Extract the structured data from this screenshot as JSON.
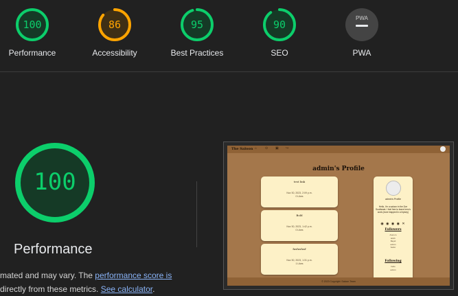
{
  "gauges": [
    {
      "score": "100",
      "label": "Performance",
      "value": 1.0,
      "color": "#0cce6b",
      "fill": "#153a26"
    },
    {
      "score": "86",
      "label": "Accessibility",
      "value": 0.86,
      "color": "#ffa400",
      "fill": "#3e2f15"
    },
    {
      "score": "95",
      "label": "Best Practices",
      "value": 0.95,
      "color": "#0cce6b",
      "fill": "#153a26"
    },
    {
      "score": "90",
      "label": "SEO",
      "value": 0.9,
      "color": "#0cce6b",
      "fill": "#153a26"
    },
    {
      "score": "",
      "label": "PWA",
      "badge": "PWA",
      "color": "#9e9e9e",
      "fill": "#444444"
    }
  ],
  "main": {
    "score": "100",
    "title": "Performance",
    "note": {
      "line1_prefix": "mated and may vary. The ",
      "line1_link": "performance score is",
      "line2_prefix": "directly from these metrics. ",
      "line2_link": "See calculator",
      "line2_suffix": "."
    }
  },
  "screenshot": {
    "brand": "The Saloon",
    "page_title": "admin's Profile",
    "posts": [
      {
        "title": "test link",
        "date": "Nov 30, 2023, 2:09 p.m.",
        "meta": "0 Likes"
      },
      {
        "title": "Bold",
        "date": "Nov 30, 2023, 1:42 p.m.",
        "meta": "0 Likes"
      },
      {
        "title": "fasfasfasf",
        "date": "Nov 30, 2023, 1:31 p.m.",
        "meta": "1 Likes"
      }
    ],
    "profile": {
      "name": "admin's Profile",
      "bio": "Hello, I'm a saloon in the Zoe Southeast. I feel free to leave hero's work (more trapped in a hiptory)",
      "social_icons": "◉ ◉ ◉ ◉ ✕",
      "followers_heading": "Followers",
      "followers": [
        "Axel-co",
        "Elizh",
        "Bayid",
        "admin",
        "Sellor"
      ],
      "following_heading": "Following",
      "following": [
        "hello",
        "admin"
      ]
    },
    "footer": "© 2023 Copyright: Saloon Team"
  }
}
